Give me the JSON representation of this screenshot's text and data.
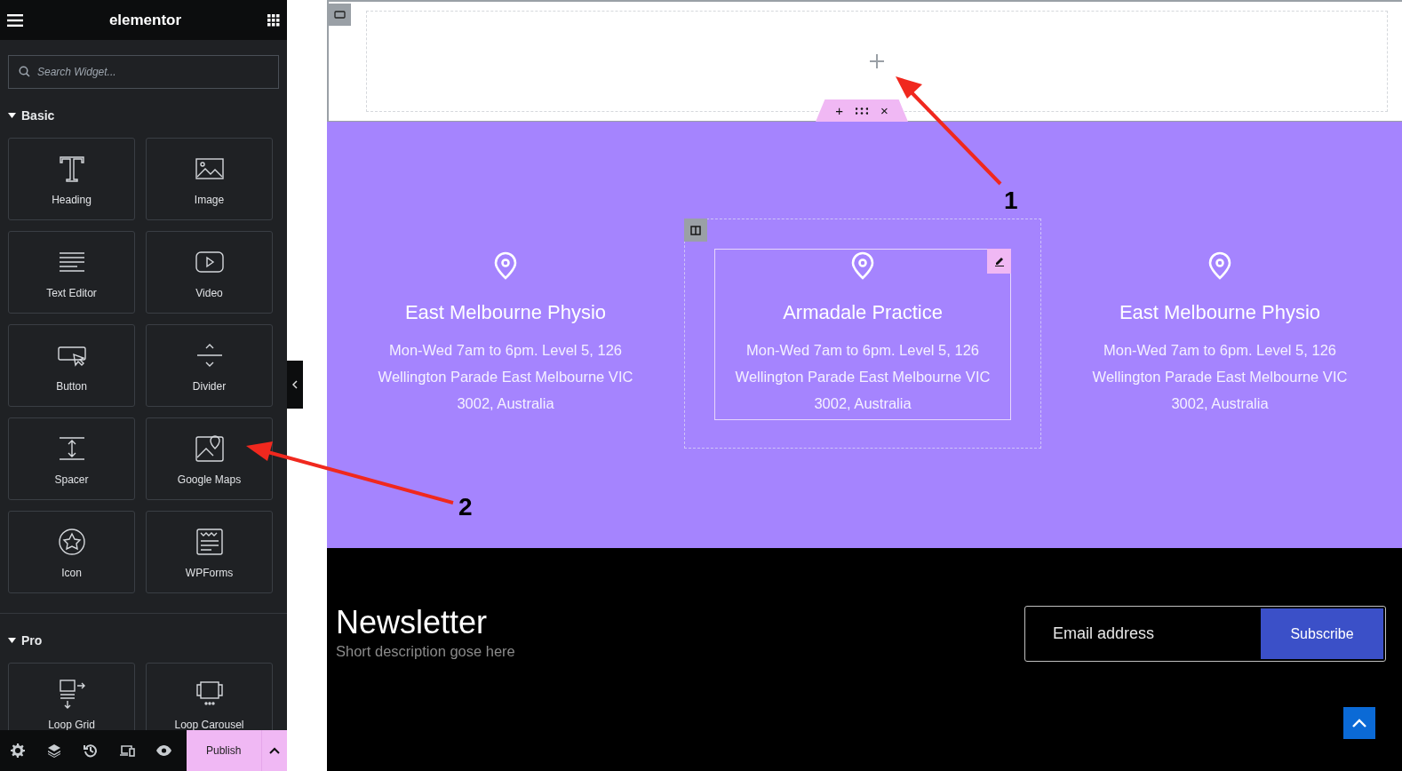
{
  "sidebar": {
    "title": "elementor",
    "search": {
      "placeholder": "Search Widget..."
    },
    "categories": [
      {
        "name": "Basic",
        "expanded": true,
        "widgets": [
          {
            "label": "Heading",
            "kind": "heading"
          },
          {
            "label": "Image",
            "kind": "image"
          },
          {
            "label": "Text Editor",
            "kind": "text"
          },
          {
            "label": "Video",
            "kind": "video"
          },
          {
            "label": "Button",
            "kind": "button"
          },
          {
            "label": "Divider",
            "kind": "divider"
          },
          {
            "label": "Spacer",
            "kind": "spacer"
          },
          {
            "label": "Google Maps",
            "kind": "map"
          },
          {
            "label": "Icon",
            "kind": "icon"
          },
          {
            "label": "WPForms",
            "kind": "form"
          }
        ]
      },
      {
        "name": "Pro",
        "expanded": true,
        "widgets": [
          {
            "label": "Loop Grid",
            "kind": "grid"
          },
          {
            "label": "Loop Carousel",
            "kind": "carousel"
          }
        ]
      }
    ],
    "footer": {
      "publish": "Publish"
    }
  },
  "canvas": {
    "empty_section": {
      "toolbar": [
        "+",
        "×"
      ]
    },
    "locations": [
      {
        "title": "East Melbourne Physio",
        "text": "Mon-Wed 7am to 6pm. Level 5, 126 Wellington Parade East Melbourne VIC 3002, Australia",
        "selected": false
      },
      {
        "title": "Armadale Practice",
        "text": "Mon-Wed 7am to 6pm. Level 5, 126 Wellington Parade East Melbourne VIC 3002, Australia",
        "selected": true
      },
      {
        "title": "East Melbourne Physio",
        "text": "Mon-Wed 7am to 6pm. Level 5, 126 Wellington Parade East Melbourne VIC 3002, Australia",
        "selected": false
      }
    ],
    "newsletter": {
      "title": "Newsletter",
      "description": "Short description gose here",
      "email": {
        "placeholder": "Email address"
      },
      "button": "Subscribe"
    }
  },
  "annotations": [
    {
      "label": "1"
    },
    {
      "label": "2"
    }
  ]
}
